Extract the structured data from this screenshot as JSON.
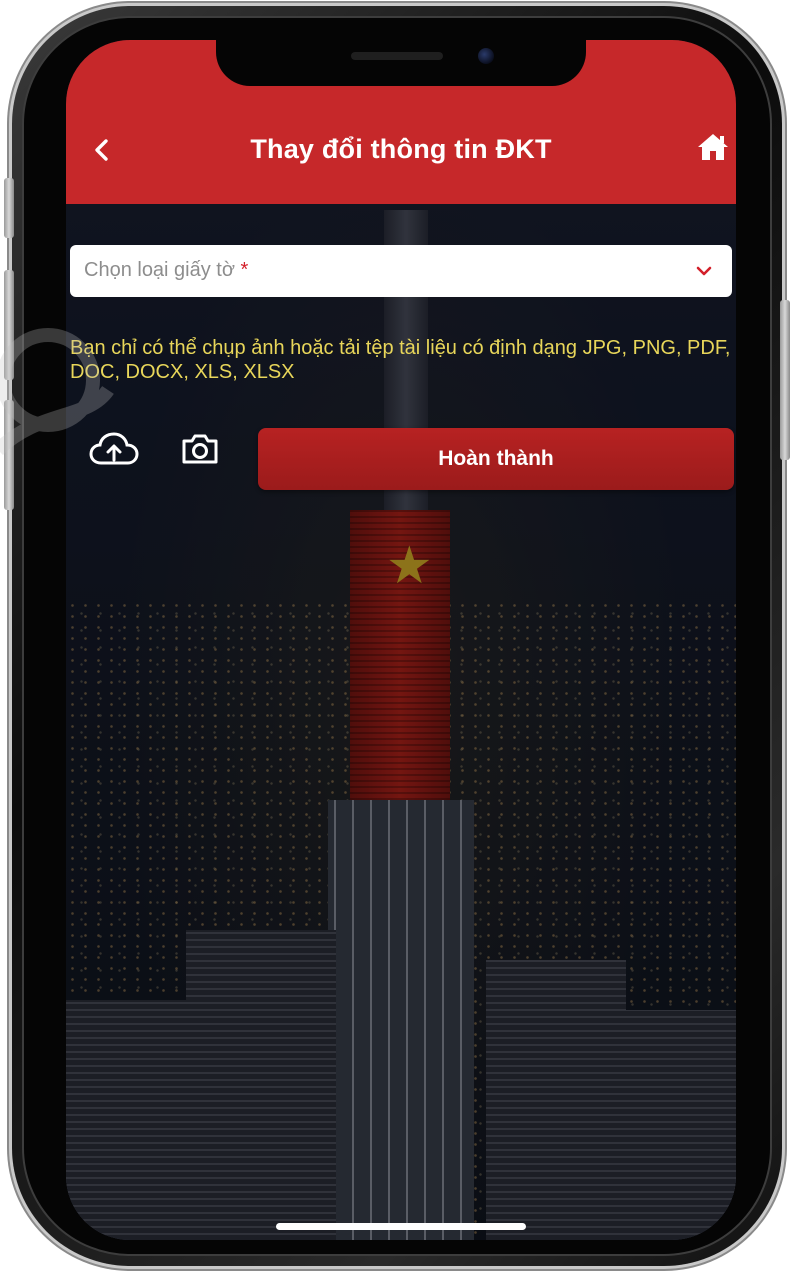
{
  "header": {
    "title": "Thay đổi thông tin ĐKT",
    "back_icon": "chevron-left-icon",
    "home_icon": "home-icon"
  },
  "form": {
    "document_type_placeholder": "Chọn loại giấy tờ",
    "required_mark": "*",
    "format_note": "Bạn chỉ có thể chụp ảnh hoặc tải tệp tài liệu có định dạng JPG, PNG, PDF, DOC, DOCX, XLS, XLSX",
    "complete_label": "Hoàn thành",
    "upload_icon": "cloud-upload-icon",
    "camera_icon": "camera-icon"
  },
  "colors": {
    "header_bg": "#c6282a",
    "note_text": "#e8d65a",
    "button_bg": "#9b1b1b",
    "required": "#d3202a"
  }
}
